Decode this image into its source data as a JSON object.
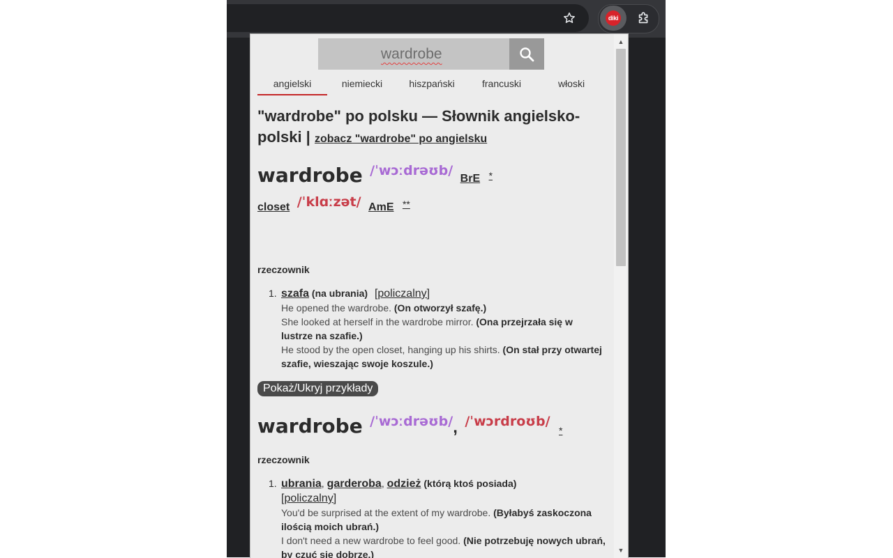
{
  "toolbar": {
    "star_icon": "star-outline-icon",
    "diki_label": "diki",
    "puzzle_icon": "extensions-puzzle-icon"
  },
  "search": {
    "value": "wardrobe",
    "icon": "magnifier-icon"
  },
  "tabs": [
    {
      "label": "angielski",
      "active": true
    },
    {
      "label": "niemiecki",
      "active": false
    },
    {
      "label": "hiszpański",
      "active": false
    },
    {
      "label": "francuski",
      "active": false
    },
    {
      "label": "włoski",
      "active": false
    }
  ],
  "heading": {
    "title": "\"wardrobe\" po polsku — Słownik angielsko-polski |",
    "see_link": "zobacz \"wardrobe\" po angielsku"
  },
  "entry1": {
    "headword": "wardrobe",
    "ipa": "/ˈwɔːdrəʊb/",
    "region": "BrE",
    "star": "*",
    "alt_word": "closet",
    "alt_ipa": "/ˈklɑːzət/",
    "alt_region": "AmE",
    "alt_star": "**",
    "pos": "rzeczownik",
    "meaning": {
      "num": "1.",
      "translation": "szafa",
      "note": "(na ubrania)",
      "category": "[policzalny]",
      "examples": [
        {
          "en": "He opened the wardrobe.",
          "pl": "(On otworzył szafę.)"
        },
        {
          "en": "She looked at herself in the wardrobe mirror.",
          "pl": "(Ona przejrzała się w lustrze na szafie.)"
        },
        {
          "en": "He stood by the open closet, hanging up his shirts.",
          "pl": "(On stał przy otwartej szafie, wieszając swoje koszule.)"
        }
      ]
    },
    "toggle": "Pokaż/Ukryj przykłady"
  },
  "entry2": {
    "headword": "wardrobe",
    "ipa_bre": "/ˈwɔːdrəʊb/",
    "sep": ",",
    "ipa_ame": "/ˈwɔrdroʊb/",
    "star": "*",
    "pos": "rzeczownik",
    "meaning": {
      "num": "1.",
      "t1": "ubrania",
      "t2": "garderoba",
      "t3": "odzież",
      "comma": ",",
      "note": "(którą ktoś posiada)",
      "category": "[policzalny]",
      "examples": [
        {
          "en": "You'd be surprised at the extent of my wardrobe.",
          "pl": "(Byłabyś zaskoczona ilością moich ubrań.)"
        },
        {
          "en": "I don't need a new wardrobe to feel good.",
          "pl": "(Nie potrzebuję nowych ubrań, by czuć się dobrze.)"
        }
      ]
    }
  },
  "colors": {
    "accent": "#c42526",
    "ipa_bre": "#a86ad4",
    "ipa_ame": "#c83d49"
  }
}
